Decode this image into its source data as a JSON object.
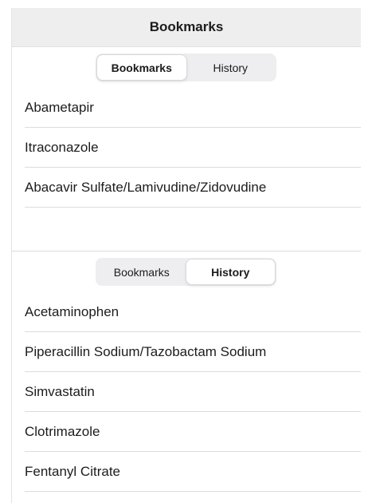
{
  "nav": {
    "title": "Bookmarks"
  },
  "top_panel": {
    "segments": [
      {
        "label": "Bookmarks",
        "selected": true
      },
      {
        "label": "History",
        "selected": false
      }
    ],
    "items": [
      "Abametapir",
      "Itraconazole",
      "Abacavir Sulfate/Lamivudine/Zidovudine"
    ]
  },
  "bottom_panel": {
    "segments": [
      {
        "label": "Bookmarks",
        "selected": false
      },
      {
        "label": "History",
        "selected": true
      }
    ],
    "items": [
      "Acetaminophen",
      "Piperacillin Sodium/Tazobactam Sodium",
      "Simvastatin",
      "Clotrimazole",
      "Fentanyl Citrate"
    ]
  },
  "colors": {
    "nav_background": "#efeeee",
    "segment_track": "#eeeef0",
    "separator": "#dcdcdf",
    "text": "#1c1c1e"
  }
}
